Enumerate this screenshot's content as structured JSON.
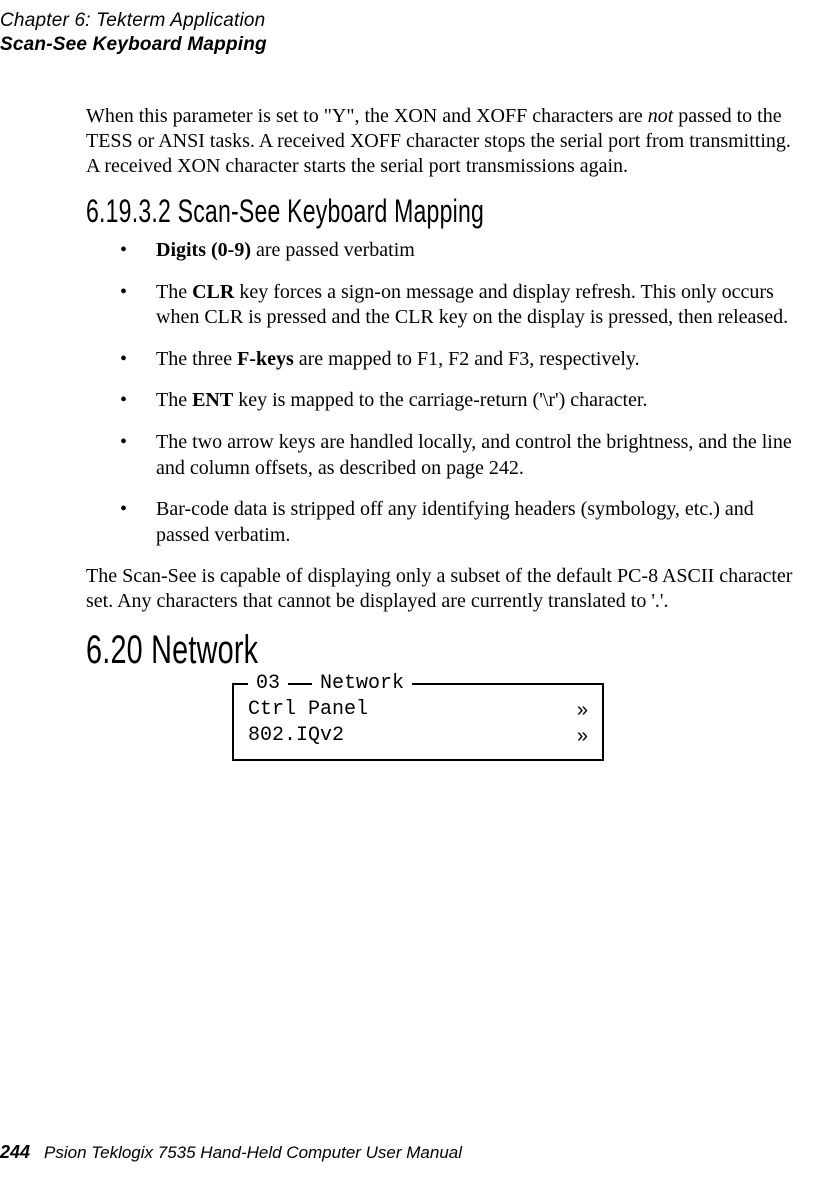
{
  "header": {
    "chapter": "Chapter 6: Tekterm Application",
    "section": "Scan-See Keyboard Mapping"
  },
  "intro": {
    "p1_a": "When this parameter is set to \"Y\", the XON and XOFF characters are ",
    "p1_not": "not",
    "p1_b": " passed to the TESS or ANSI tasks. A received XOFF character stops the serial port from transmitting. A received XON character starts the serial port transmissions again."
  },
  "h3": "6.19.3.2  Scan-See Keyboard Mapping",
  "bullets": [
    {
      "bold": "Digits (0-9)",
      "rest": " are passed verbatim"
    },
    {
      "pre": "The ",
      "bold": "CLR",
      "rest": " key forces a sign-on message and display refresh. This only occurs when CLR is pressed and the CLR key on the display is pressed, then released."
    },
    {
      "pre": "The three ",
      "bold": "F-keys",
      "rest": " are mapped to F1, F2 and F3, respectively."
    },
    {
      "pre": "The ",
      "bold": "ENT",
      "rest": " key is mapped to the carriage-return ('\\r') character."
    },
    {
      "text": "The two arrow keys are handled locally, and control the brightness, and the line and column offsets, as described on page 242."
    },
    {
      "text": "Bar-code data is stripped off any identifying headers (symbology, etc.) and passed verbatim."
    }
  ],
  "after": "The Scan-See is capable of displaying only a subset of the default PC-8 ASCII character set. Any characters that cannot be displayed are currently translated to '.'.",
  "h2": "6.20  Network",
  "menu": {
    "num": "03",
    "title": "Network",
    "rows": [
      {
        "label": "Ctrl Panel",
        "arrow": "»"
      },
      {
        "label": "802.IQv2",
        "arrow": "»"
      }
    ]
  },
  "footer": {
    "page": "244",
    "text": "Psion Teklogix 7535 Hand-Held Computer User Manual"
  }
}
